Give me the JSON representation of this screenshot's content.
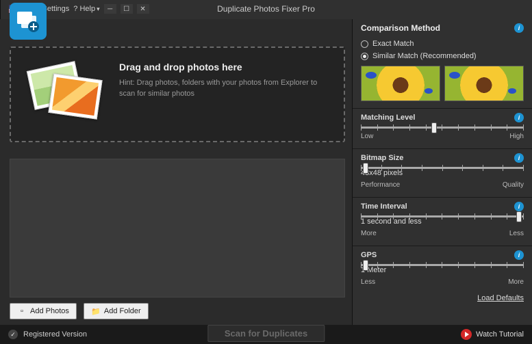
{
  "title": "Duplicate Photos Fixer Pro",
  "titlebar": {
    "settings": "Settings",
    "help": "? Help"
  },
  "dropzone": {
    "heading": "Drag and drop photos here",
    "hint": "Hint: Drag photos, folders with your photos from Explorer to scan for similar photos"
  },
  "buttons": {
    "add_photos": "Add Photos",
    "add_folder": "Add Folder"
  },
  "panel": {
    "comparison": "Comparison Method",
    "exact": "Exact Match",
    "similar": "Similar Match (Recommended)",
    "matching": {
      "title": "Matching Level",
      "low": "Low",
      "high": "High"
    },
    "bitmap": {
      "title": "Bitmap Size",
      "left": "Performance",
      "mid": "48x48 pixels",
      "right": "Quality"
    },
    "time": {
      "title": "Time Interval",
      "left": "More",
      "mid": "1 second and less",
      "right": "Less"
    },
    "gps": {
      "title": "GPS",
      "left": "Less",
      "mid": "1 Meter",
      "right": "More"
    },
    "defaults": "Load Defaults"
  },
  "footer": {
    "registered": "Registered Version",
    "scan": "Scan for Duplicates",
    "watch": "Watch Tutorial"
  }
}
